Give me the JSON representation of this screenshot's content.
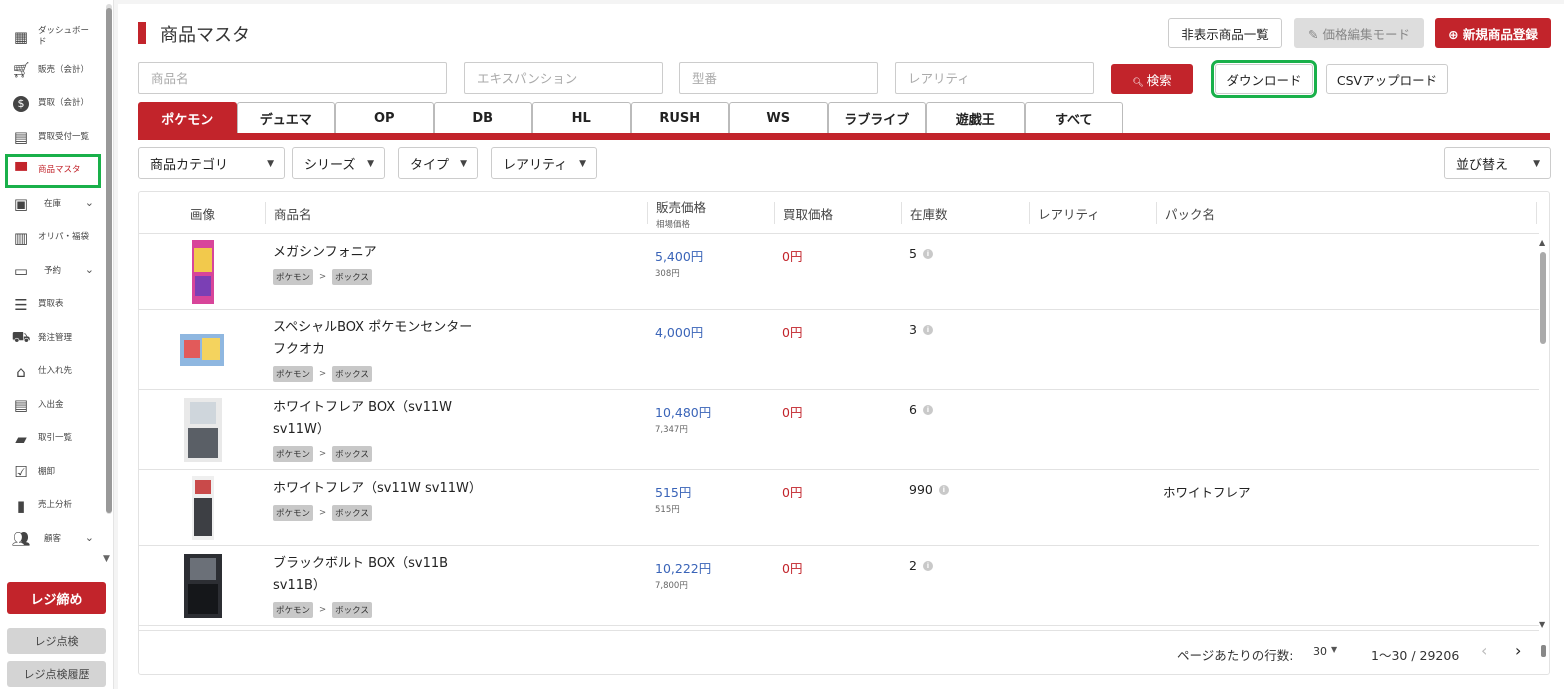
{
  "sidebar": {
    "items": [
      {
        "label": "ダッシュボード",
        "icon": "dashboard-icon"
      },
      {
        "label": "販売（会計）",
        "icon": "cart-icon"
      },
      {
        "label": "買取（会計）",
        "icon": "dollar-icon"
      },
      {
        "label": "買取受付一覧",
        "icon": "receipt-icon"
      },
      {
        "label": "商品マスタ",
        "icon": "store-icon",
        "active": true
      },
      {
        "label": "在庫",
        "icon": "inventory-icon",
        "expandable": true
      },
      {
        "label": "オリパ・福袋",
        "icon": "gift-icon"
      },
      {
        "label": "予約",
        "icon": "reservation-icon",
        "expandable": true
      },
      {
        "label": "買取表",
        "icon": "list-icon"
      },
      {
        "label": "発注管理",
        "icon": "truck-icon"
      },
      {
        "label": "仕入れ先",
        "icon": "warehouse-icon"
      },
      {
        "label": "入出金",
        "icon": "register-icon"
      },
      {
        "label": "取引一覧",
        "icon": "folder-icon"
      },
      {
        "label": "棚卸",
        "icon": "checklist-icon"
      },
      {
        "label": "売上分析",
        "icon": "bar-chart-icon"
      },
      {
        "label": "顧客",
        "icon": "people-icon",
        "expandable": true
      }
    ],
    "register_close": "レジ締め",
    "register_check": "レジ点検",
    "register_check_history": "レジ点検履歴"
  },
  "header": {
    "title": "商品マスタ",
    "hidden_list": "非表示商品一覧",
    "price_edit": "価格編集モード",
    "new_product": "新規商品登録"
  },
  "search": {
    "name_placeholder": "商品名",
    "expansion_placeholder": "エキスパンション",
    "model_placeholder": "型番",
    "rarity_placeholder": "レアリティ",
    "search_button": "検索",
    "download": "ダウンロード",
    "csv_upload": "CSVアップロード"
  },
  "tabs": [
    "ポケモン",
    "デュエマ",
    "OP",
    "DB",
    "HL",
    "RUSH",
    "WS",
    "ラブライブ",
    "遊戯王",
    "すべて"
  ],
  "filters": {
    "category": "商品カテゴリ",
    "series": "シリーズ",
    "type": "タイプ",
    "rarity": "レアリティ",
    "sort": "並び替え"
  },
  "table": {
    "headers": {
      "image": "画像",
      "name": "商品名",
      "sell_price": "販売価格",
      "market_price": "相場価格",
      "buy_price": "買取価格",
      "stock": "在庫数",
      "rarity": "レアリティ",
      "pack": "パック名"
    },
    "rows": [
      {
        "name_line1": "メガシンフォニア",
        "name_line2": "",
        "tag1": "ポケモン",
        "tag2": "ボックス",
        "sell": "5,400円",
        "market": "308円",
        "buy": "0円",
        "stock": "5",
        "pack": ""
      },
      {
        "name_line1": "スペシャルBOX ポケモンセンター",
        "name_line2": "フクオカ",
        "tag1": "ポケモン",
        "tag2": "ボックス",
        "sell": "4,000円",
        "market": "",
        "buy": "0円",
        "stock": "3",
        "pack": ""
      },
      {
        "name_line1": "ホワイトフレア BOX（sv11W",
        "name_line2": "sv11W）",
        "tag1": "ポケモン",
        "tag2": "ボックス",
        "sell": "10,480円",
        "market": "7,347円",
        "buy": "0円",
        "stock": "6",
        "pack": ""
      },
      {
        "name_line1": "ホワイトフレア（sv11W sv11W）",
        "name_line2": "",
        "tag1": "ポケモン",
        "tag2": "ボックス",
        "sell": "515円",
        "market": "515円",
        "buy": "0円",
        "stock": "990",
        "pack": "ホワイトフレア"
      },
      {
        "name_line1": "ブラックボルト BOX（sv11B",
        "name_line2": "sv11B）",
        "tag1": "ポケモン",
        "tag2": "ボックス",
        "sell": "10,222円",
        "market": "7,800円",
        "buy": "0円",
        "stock": "2",
        "pack": ""
      }
    ],
    "tag_separator": ">"
  },
  "pagination": {
    "rows_per_page_label": "ページあたりの行数:",
    "rows_per_page": "30",
    "range": "1〜30 / 29206"
  },
  "colors": {
    "accent": "#c2242b",
    "highlight": "#19b04a",
    "sell_price": "#3a64b8"
  }
}
